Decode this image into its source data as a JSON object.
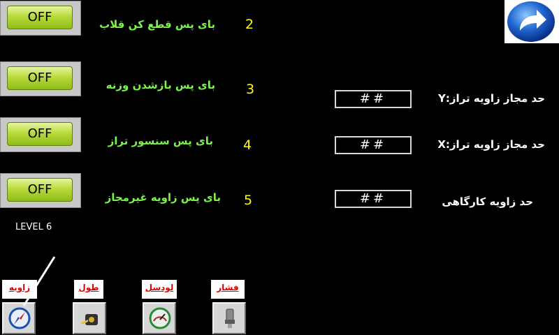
{
  "rows": [
    {
      "num": "2",
      "label": "بای پس قطع کن قلاب",
      "button": "OFF"
    },
    {
      "num": "3",
      "label": "بای پس بازشدن وزنه",
      "button": "OFF"
    },
    {
      "num": "4",
      "label": "بای پس سنسور تراز",
      "button": "OFF"
    },
    {
      "num": "5",
      "label": "بای پس زاویه غیرمجاز",
      "button": "OFF"
    }
  ],
  "fields": [
    {
      "label": "حد مجاز زاویه تراز:Y",
      "value": "##"
    },
    {
      "label": "حد مجاز زاویه تراز:X",
      "value": "##"
    },
    {
      "label": "حد زاویه کارگاهی",
      "value": "##"
    }
  ],
  "level_text": "LEVEL 6",
  "nav": [
    {
      "label": "زاویه",
      "icon": "compass-icon"
    },
    {
      "label": "طول",
      "icon": "tape-measure-icon"
    },
    {
      "label": "لودسل",
      "icon": "gauge-icon"
    },
    {
      "label": "فشار",
      "icon": "pressure-sensor-icon"
    }
  ],
  "back_icon": "forward-arrow-icon",
  "colors": {
    "background": "#000000",
    "row_label": "#7cf24c",
    "row_number": "#ffff00",
    "nav_label": "#e10000",
    "button_green": "#a8cc2c"
  }
}
